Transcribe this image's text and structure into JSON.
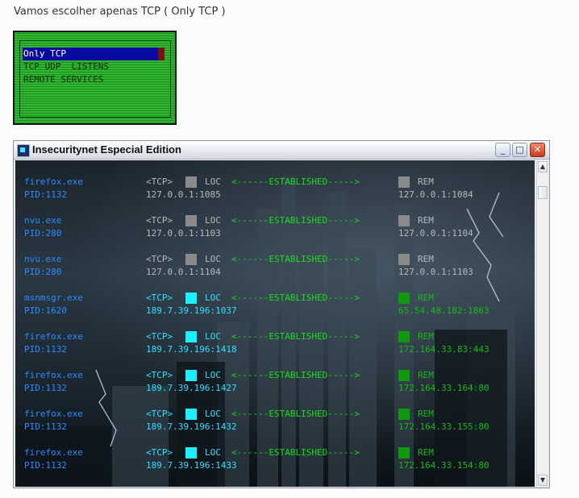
{
  "caption": "Vamos escolher apenas TCP ( Only TCP )",
  "menu": {
    "items": [
      "Only TCP",
      "TCP UDP  LISTENS",
      "REMOTE SERVICES"
    ]
  },
  "window": {
    "title": "Insecuritynet Especial Edition",
    "buttons": {
      "minimize": "_",
      "maximize": "□",
      "close": "✕"
    },
    "scroll": {
      "up": "▲",
      "down": "▼"
    }
  },
  "colors": {
    "process_blue": "#2a8cff",
    "established_green": "#1bdc1b",
    "local_cyan": "#19f0ff",
    "remote_green": "#0d9a0d",
    "idle_gray": "#8a8a8a"
  },
  "connections": [
    {
      "process": "firefox.exe",
      "pid": "PID:1132",
      "protocol": "<TCP>",
      "loc_label": "LOC",
      "state": "<------ESTABLISHED----->",
      "rem_label": "REM",
      "local": "127.0.0.1:1085",
      "remote": "127.0.0.1:1084",
      "kind": "idle"
    },
    {
      "process": "nvu.exe",
      "pid": "PID:280",
      "protocol": "<TCP>",
      "loc_label": "LOC",
      "state": "<------ESTABLISHED----->",
      "rem_label": "REM",
      "local": "127.0.0.1:1103",
      "remote": "127.0.0.1:1104",
      "kind": "idle"
    },
    {
      "process": "nvu.exe",
      "pid": "PID:280",
      "protocol": "<TCP>",
      "loc_label": "LOC",
      "state": "<------ESTABLISHED----->",
      "rem_label": "REM",
      "local": "127.0.0.1:1104",
      "remote": "127.0.0.1:1103",
      "kind": "idle"
    },
    {
      "process": "msnmsgr.exe",
      "pid": "PID:1620",
      "protocol": "<TCP>",
      "loc_label": "LOC",
      "state": "<------ESTABLISHED----->",
      "rem_label": "REM",
      "local": "189.7.39.196:1037",
      "remote": "65.54.48.182:1863",
      "kind": "active"
    },
    {
      "process": "firefox.exe",
      "pid": "PID:1132",
      "protocol": "<TCP>",
      "loc_label": "LOC",
      "state": "<------ESTABLISHED----->",
      "rem_label": "REM",
      "local": "189.7.39.196:1418",
      "remote": "172.164.33.83:443",
      "kind": "active"
    },
    {
      "process": "firefox.exe",
      "pid": "PID:1132",
      "protocol": "<TCP>",
      "loc_label": "LOC",
      "state": "<------ESTABLISHED----->",
      "rem_label": "REM",
      "local": "189.7.39.196:1427",
      "remote": "172.164.33.164:80",
      "kind": "active"
    },
    {
      "process": "firefox.exe",
      "pid": "PID:1132",
      "protocol": "<TCP>",
      "loc_label": "LOC",
      "state": "<------ESTABLISHED----->",
      "rem_label": "REM",
      "local": "189.7.39.196:1432",
      "remote": "172.164.33.155:80",
      "kind": "active"
    },
    {
      "process": "firefox.exe",
      "pid": "PID:1132",
      "protocol": "<TCP>",
      "loc_label": "LOC",
      "state": "<------ESTABLISHED----->",
      "rem_label": "REM",
      "local": "189.7.39.196:1433",
      "remote": "172.164.33.154:80",
      "kind": "active"
    }
  ]
}
